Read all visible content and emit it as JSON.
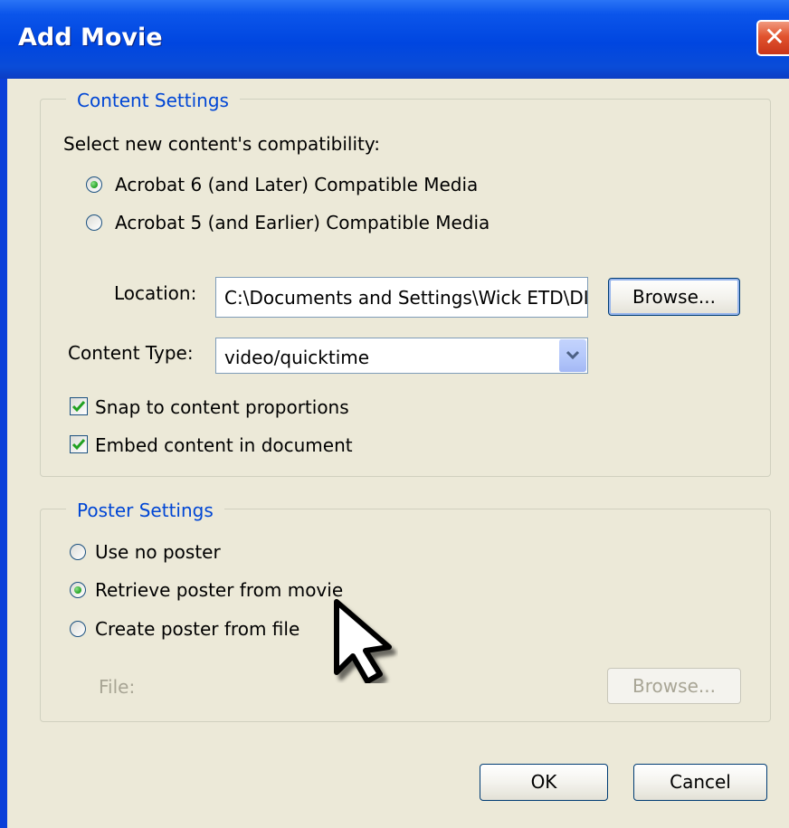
{
  "window": {
    "title": "Add Movie",
    "close_label": "✕"
  },
  "content_settings": {
    "legend": "Content Settings",
    "compat_prompt": "Select new content's compatibility:",
    "compat_options": [
      {
        "label": "Acrobat 6 (and Later) Compatible Media",
        "selected": true
      },
      {
        "label": "Acrobat 5 (and Earlier) Compatible Media",
        "selected": false
      }
    ],
    "location_label": "Location:",
    "location_value": "C:\\Documents and Settings\\Wick ETD\\DII",
    "browse_label": "Browse...",
    "content_type_label": "Content Type:",
    "content_type_value": "video/quicktime",
    "snap_label": "Snap to content proportions",
    "snap_checked": true,
    "embed_label": "Embed content in document",
    "embed_checked": true
  },
  "poster_settings": {
    "legend": "Poster Settings",
    "options": [
      {
        "label": "Use no poster",
        "selected": false
      },
      {
        "label": "Retrieve poster from movie",
        "selected": true
      },
      {
        "label": "Create poster from file",
        "selected": false
      }
    ],
    "file_label": "File:",
    "browse_label": "Browse..."
  },
  "buttons": {
    "ok_label": "OK",
    "cancel_label": "Cancel"
  },
  "colors": {
    "title_bar": "#0046e0",
    "dialog_bg": "#ece9d8",
    "legend_text": "#0046d5",
    "checkmark": "#21a121"
  },
  "icons": {
    "close": "close-icon",
    "dropdown": "chevron-down-icon",
    "cursor": "mouse-pointer-icon"
  }
}
